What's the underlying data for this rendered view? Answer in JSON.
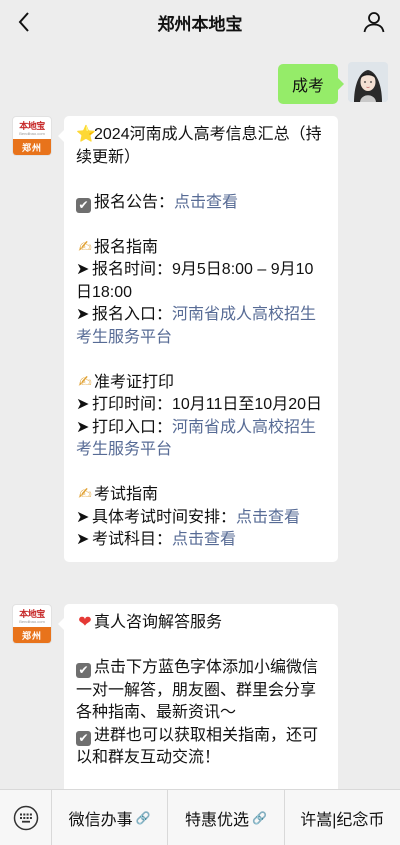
{
  "header": {
    "title": "郑州本地宝"
  },
  "outgoing": {
    "text": "成考"
  },
  "brand_avatar": {
    "name": "本地宝",
    "url": "Bendibao.com",
    "city": "郑州"
  },
  "message1": {
    "lines": [
      {
        "emoji": "⭐",
        "text": "2024河南成人高考信息汇总（持续更新）"
      },
      {
        "check": "✔",
        "label": "报名公告：",
        "link": "点击查看"
      },
      {
        "emoji": "✍",
        "text": "报名指南"
      },
      {
        "arrow": "➤",
        "text": "报名时间：9月5日8:00 – 9月10日18:00"
      },
      {
        "arrow": "➤",
        "label": "报名入口：",
        "link": "河南省成人高校招生考生服务平台"
      },
      {
        "emoji": "✍",
        "text": "准考证打印"
      },
      {
        "arrow": "➤",
        "text": "打印时间：10月11日至10月20日"
      },
      {
        "arrow": "➤",
        "label": "打印入口：",
        "link": "河南省成人高校招生考生服务平台"
      },
      {
        "emoji": "✍",
        "text": "考试指南"
      },
      {
        "arrow": "➤",
        "label": "具体考试时间安排：",
        "link": "点击查看"
      },
      {
        "arrow": "➤",
        "label": "考试科目：",
        "link": "点击查看"
      }
    ]
  },
  "message2": {
    "heart": "❤",
    "title": "真人咨询解答服务",
    "check": "✔",
    "para1": "点击下方蓝色字体添加小编微信一对一解答，朋友圈、群里会分享各种指南、最新资讯～",
    "para2": "进群也可以获取相关指南，还可以和群友互动交流！"
  },
  "menu": {
    "items": [
      {
        "label": "微信办事",
        "icon": "link-icon"
      },
      {
        "label": "特惠优选",
        "icon": "link-icon"
      },
      {
        "label": "许嵩|纪念币"
      }
    ]
  },
  "colors": {
    "link": "#576b95",
    "bubble_out": "#95ec69",
    "brand_orange": "#e8731b"
  }
}
